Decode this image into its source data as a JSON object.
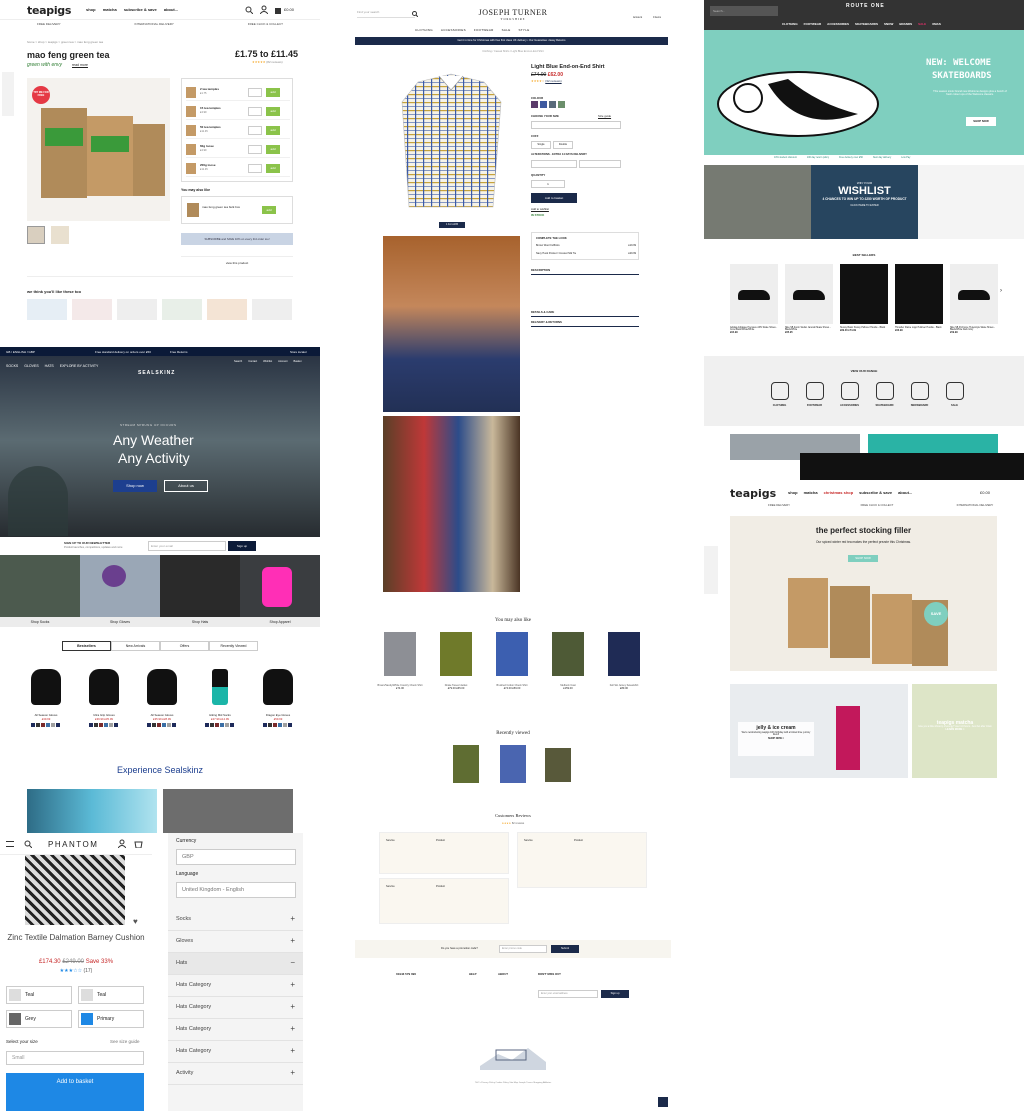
{
  "teapigs_pdp": {
    "logo": "teapigs",
    "nav": [
      "shop",
      "matcha",
      "subscribe & save",
      "about..."
    ],
    "basket": "£0.00",
    "usps": [
      "FREE DELIVERY",
      "INTERNATIONAL DELIVERY",
      "FREE CLICK & COLLECT"
    ],
    "breadcrumb": "home > shop > teapigs > green tea > mao feng green tea",
    "title": "mao feng green tea",
    "subtitle": "green with envy",
    "read_more": "read more",
    "price": "£1.75 to £11.45",
    "reviews": "(82 reviews)",
    "options": [
      {
        "label": "2 tea temples",
        "price": "£1.75"
      },
      {
        "label": "15 tea temples",
        "price": "£4.99"
      },
      {
        "label": "50 tea temples",
        "price": "£11.45"
      },
      {
        "label": "60g loose",
        "price": "£4.99"
      },
      {
        "label": "200g loose",
        "price": "£11.45"
      }
    ],
    "add_label": "add",
    "also_like": "You may also like",
    "also_item": "mao feng green tea bulk box",
    "subscribe_cta": "SUBSCRIBE and SAVE 10% on every 3rd order too!",
    "view_protect": "view this product",
    "think_like": "we think you'll like these too",
    "badge": "TRY ME FOR FREE"
  },
  "sealskinz": {
    "topbar": [
      "GB / ENGLISH / GBP",
      "Free standard delivery on orders over £50",
      "Free Returns",
      "Store locator"
    ],
    "nav": [
      "SOCKS",
      "GLOVES",
      "HATS",
      "EXPLORE BY ACTIVITY"
    ],
    "logo": "SEALSKINZ",
    "icons": [
      "Search",
      "Contact",
      "Wishlist",
      "Account",
      "Basket"
    ],
    "hero_kicker": "STREAM SPRUNG UP OCCURS",
    "hero_line1": "Any Weather",
    "hero_line2": "Any Activity",
    "shop_now": "Shop now",
    "about_us": "About us",
    "newsletter_title": "SIGN UP TO OUR NEWSLETTER",
    "newsletter_sub": "Product launches, competitions, updates and more",
    "email_placeholder": "Enter your email",
    "sign_up": "Sign up",
    "categories": [
      "Shop Socks",
      "Shop Gloves",
      "Shop Hats",
      "Shop Apparel"
    ],
    "tabs": [
      "Bestsellers",
      "New Arrivals",
      "Offers",
      "Recently Viewed"
    ],
    "products": [
      {
        "name": "All Season Gloves",
        "price": "£39.99"
      },
      {
        "name": "Ultra Grip Gloves",
        "price": "£39.99 £35.99"
      },
      {
        "name": "All Season Gloves",
        "price": "£35.99 £28.99"
      },
      {
        "name": "Hiking Mid Socks",
        "price": "£27.99 £14.99"
      },
      {
        "name": "Dragon Eye Gloves",
        "price": "£59.99"
      }
    ],
    "experience": "Experience Sealskinz"
  },
  "joseph_turner": {
    "search_placeholder": "Find your search",
    "logo_line1": "JOSEPH TURNER",
    "logo_line2": "YORKSHIRE",
    "icons": [
      "Account",
      "0 items"
    ],
    "nav": [
      "CLOTHING",
      "ACCESSORIES",
      "FOOTWEAR",
      "SALE",
      "STYLE"
    ],
    "banner": "Get it in time for Christmas with free first class UK delivery  •  Our Guarantee  •  Easy Returns",
    "breadcrumb": "Clothing / Casual Shirts / Light Blue End-on-End Shirt",
    "title": "Light Blue End-on-End Shirt",
    "price_old": "£74.00",
    "price_new": "£62.00",
    "rating_count": "(32 reviews)",
    "color_label": "COLOUR",
    "size_label": "CHOOSE YOUR SIZE",
    "size_guide": "Size guide",
    "cuff_label": "CUFF",
    "cuff_options": [
      "Single",
      "Double"
    ],
    "alteration": "ALTERATIONS - EXTRA 14 DAYS DELIVERY",
    "qty_label": "QUANTITY",
    "qty": "1",
    "add_basket": "Add to basket",
    "wishlist": "Add to wishlist",
    "stock": "IN STOCK",
    "complete_look": "COMPLETE THE LOOK",
    "look_items": [
      {
        "name": "Brown Wool Cufflinks",
        "price": "£19.99"
      },
      {
        "name": "Navy Hook Pocket / Crested Silk Tie",
        "price": "£29.99"
      }
    ],
    "accordions": [
      "DESCRIPTION",
      "DETAILS & CARE",
      "DELIVERY & RETURNS"
    ],
    "thumb_cta": "1 For £165",
    "also_like": "You may also like",
    "also_items": [
      {
        "name": "Brown/Sandy/White Country Check Shirt",
        "price": "£74.00"
      },
      {
        "name": "Drake Tweed Jacket",
        "price": "£79.00 £65.00"
      },
      {
        "name": "Brushed Cotton Check Shirt",
        "price": "£74.00 £59.00"
      },
      {
        "name": "Melbuck Coat",
        "price": "£159.00"
      },
      {
        "name": "Fell Ski Jersey Sweatshirt",
        "price": "£89.00"
      }
    ],
    "recently_viewed": "Recently viewed",
    "reviews_title": "Customers Reviews",
    "reviews_count": "82 reviews",
    "review_labels": [
      "Service",
      "Product"
    ],
    "newsletter_q": "Do you have a promotion code?",
    "newsletter_placeholder": "Enter promo code",
    "submit": "Submit",
    "phone": "01943 579 090",
    "footer_cols": [
      "HELP",
      "ABOUT",
      "DON'T MISS OUT"
    ],
    "footer_email_placeholder": "Enter your email address",
    "sign_up": "Sign up",
    "copyright": "T&C's  Privacy Policy  Cookie Policy  Site Map  Joseph Turner Shopping Affiliates"
  },
  "route_one": {
    "search_placeholder": "Search...",
    "logo": "ROUTE ONE",
    "nav": [
      "CLOTHING",
      "FOOTWEAR",
      "ACCESSORIES",
      "SKATEBOARDS",
      "SNOW",
      "BRANDS",
      "SALE",
      "XMAS"
    ],
    "hero_title1": "NEW: WELCOME",
    "hero_title2": "SKATEBOARDS",
    "hero_text": "This season iconic brand new Welcome designs plus a bunch of fresh colour ups of the Welcome classics.",
    "shop_now": "SHOP NOW",
    "usps": [
      "10% student discount",
      "100 day return policy",
      "Free delivery over £50",
      "Next day delivery",
      "Low Pay"
    ],
    "wishlist_kicker": "WIN YOUR",
    "wishlist_title": "WISHLIST",
    "wishlist_sub": "4 CHANCES TO WIN UP TO £250 WORTH OF PRODUCT",
    "wishlist_cta": "CLICK HERE TO ENTER",
    "best_sellers": "BEST SELLERS",
    "products": [
      {
        "name": "Adidas Adi-Ease Premiere ADV Skate Shoes - Core Black/White/White",
        "price": "£64.99"
      },
      {
        "name": "Nike SB Zoom Stefan Janoski Skate Shoes - Black/White",
        "price": "£65.95"
      },
      {
        "name": "Stussy Basic Stussy Pullover Hoodie - Black",
        "price": "£89.00 £74.99"
      },
      {
        "name": "Thrasher Flame Logo Pullover Hoodie - Black",
        "price": "£66.99"
      },
      {
        "name": "Nike SB Portmore Hyperstyle Skate Shoes - Black/White Dark Grey",
        "price": "£59.99"
      }
    ],
    "view_range": "VIEW OUR RANGE",
    "range": [
      "CLOTHING",
      "FOOTWEAR",
      "ACCESSORIES",
      "SKATEBOARD",
      "SNOWBOARD",
      "SALE"
    ]
  },
  "teapigs_home": {
    "logo": "teapigs",
    "nav": [
      "shop",
      "matcha",
      "christmas shop",
      "subscribe & save",
      "about..."
    ],
    "basket": "£0.00",
    "usps": [
      "FREE DELIVERY",
      "FREE CLICK & COLLECT",
      "INTERNATIONAL DELIVERY"
    ],
    "hero_title": "the perfect stocking filler",
    "hero_sub": "Our spiced winter red tea makes the perfect prezzie this Christmas.",
    "shop_now": "SHOP NOW",
    "save_badge": "SAVE",
    "promo1_title": "jelly & ice cream",
    "promo1_text": "We're reintroducing teapigs 10th birthday with a limited time yummy blend!",
    "promo1_cta": "SHOP NOW >",
    "promo2_title": "teapigs matcha",
    "promo2_text": "Give you a little vibrancy of energy? over 4-6 hours - best bet after 10am",
    "promo2_cta": "LEARN MORE >"
  },
  "phantom": {
    "logo": "PHANTOM",
    "product_title": "Zinc Textile Dalmation Barney Cushion",
    "price": "£174.30",
    "price_old": "£249.00",
    "save": "Save 33%",
    "reviews": "(17)",
    "colours": [
      "Teal",
      "Teal",
      "Grey",
      "Primary"
    ],
    "size_label": "Select your size",
    "size_guide": "See size guide",
    "size_placeholder": "Small",
    "add_basket": "Add to basket"
  },
  "filter_panel": {
    "currency_label": "Currency",
    "currency": "GBP",
    "language_label": "Language",
    "language": "United Kingdom - English",
    "items": [
      "Socks",
      "Gloves",
      "Hats",
      "Hats Category",
      "Hats Category",
      "Hats Category",
      "Hats Category",
      "Activity"
    ]
  },
  "colors": {
    "teapigs_green": "#2e7d32",
    "jt_navy": "#1b2a4a",
    "sealskinz_blue": "#1d3f8f",
    "route_pink": "#e8306b",
    "route_teal": "#7fcfbf",
    "phantom_blue": "#1e88e5"
  }
}
